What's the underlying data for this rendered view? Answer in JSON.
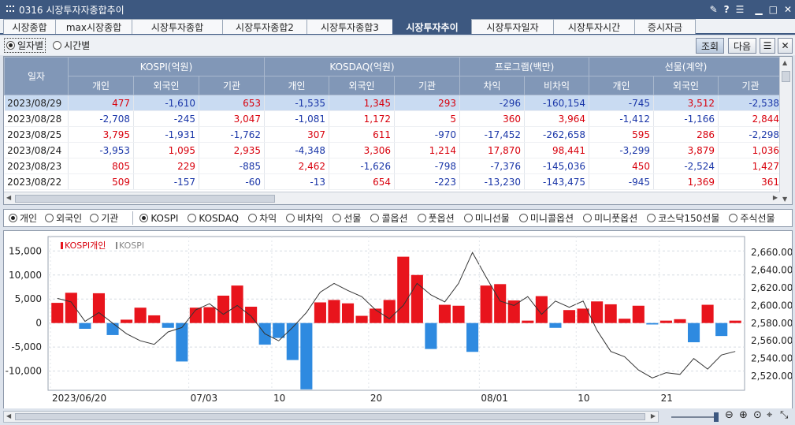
{
  "window": {
    "title": "0316 시장투자자종합추이",
    "controls": [
      "pin",
      "?",
      "menu",
      "min",
      "max",
      "close"
    ]
  },
  "tabs": [
    "시장종합",
    "max시장종합",
    "시장투자종합",
    "시장투자종합2",
    "시장투자종합3",
    "시장투자추이",
    "시장투자일자",
    "시장투자시간",
    "증시자금"
  ],
  "active_tab": 5,
  "period_options": [
    "일자별",
    "시간별"
  ],
  "buttons": {
    "query": "조회",
    "next": "다음"
  },
  "grid": {
    "date_header": "일자",
    "groups": [
      "KOSPI(억원)",
      "KOSDAQ(억원)",
      "프로그램(백만)",
      "선물(계약)"
    ],
    "subheaders": [
      "개인",
      "외국인",
      "기관",
      "개인",
      "외국인",
      "기관",
      "차익",
      "비차익",
      "개인",
      "외국인",
      "기관"
    ],
    "rows": [
      {
        "date": "2023/08/29",
        "values": [
          "477",
          "-1,610",
          "653",
          "-1,535",
          "1,345",
          "293",
          "-296",
          "-160,154",
          "-745",
          "3,512",
          "-2,538"
        ]
      },
      {
        "date": "2023/08/28",
        "values": [
          "-2,708",
          "-245",
          "3,047",
          "-1,081",
          "1,172",
          "5",
          "360",
          "3,964",
          "-1,412",
          "-1,166",
          "2,844"
        ]
      },
      {
        "date": "2023/08/25",
        "values": [
          "3,795",
          "-1,931",
          "-1,762",
          "307",
          "611",
          "-970",
          "-17,452",
          "-262,658",
          "595",
          "286",
          "-2,298"
        ]
      },
      {
        "date": "2023/08/24",
        "values": [
          "-3,953",
          "1,095",
          "2,935",
          "-4,348",
          "3,306",
          "1,214",
          "17,870",
          "98,441",
          "-3,299",
          "3,879",
          "1,036"
        ]
      },
      {
        "date": "2023/08/23",
        "values": [
          "805",
          "229",
          "-885",
          "2,462",
          "-1,626",
          "-798",
          "-7,376",
          "-145,036",
          "450",
          "-2,524",
          "1,427"
        ]
      },
      {
        "date": "2023/08/22",
        "values": [
          "509",
          "-157",
          "-60",
          "-13",
          "654",
          "-223",
          "-13,230",
          "-143,475",
          "-945",
          "1,369",
          "361"
        ]
      }
    ]
  },
  "investor_options": [
    "개인",
    "외국인",
    "기관"
  ],
  "market_options": [
    "KOSPI",
    "KOSDAQ",
    "차익",
    "비차익",
    "선물",
    "콜옵션",
    "풋옵션",
    "미니선물",
    "미니콜옵션",
    "미니풋옵션",
    "코스닥150선물",
    "주식선물"
  ],
  "colors": {
    "pos": "#d8000c",
    "neg": "#1a36a8",
    "bar_pos": "#e8141c",
    "bar_neg": "#2e8ae0",
    "header": "#8197b7",
    "title": "#3d5880"
  },
  "chart_data": {
    "type": "bar",
    "legend": [
      "KOSPI개인",
      "KOSPI"
    ],
    "x_ticks": [
      "2023/06/20",
      "07/03",
      "10",
      "20",
      "08/01",
      "10",
      "21"
    ],
    "y_left_ticks": [
      "15,000",
      "10,000",
      "5,000",
      "0",
      "-5,000",
      "-10,000"
    ],
    "y_right_ticks": [
      "2,660.00",
      "2,640.00",
      "2,620.00",
      "2,600.00",
      "2,580.00",
      "2,560.00",
      "2,540.00",
      "2,520.00"
    ],
    "ylim_left": [
      -14000,
      18000
    ],
    "ylim_right": [
      2504,
      2678
    ],
    "series": [
      {
        "name": "KOSPI개인",
        "values": [
          4200,
          6300,
          -1200,
          6200,
          -2500,
          700,
          3200,
          1600,
          -1000,
          -8000,
          3200,
          3300,
          5700,
          7800,
          3400,
          -4500,
          -3100,
          -7700,
          -13800,
          4300,
          4800,
          4100,
          1500,
          3000,
          4800,
          13800,
          10000,
          -5400,
          3800,
          3600,
          -6000,
          7800,
          8100,
          4700,
          500,
          5600,
          -1000,
          2700,
          3000,
          4500,
          3900,
          900,
          3600,
          -300,
          500,
          800,
          -4000,
          3800,
          -2700,
          500
        ]
      },
      {
        "name": "KOSPI",
        "values": [
          2608,
          2604,
          2582,
          2592,
          2580,
          2568,
          2560,
          2556,
          2570,
          2575,
          2595,
          2602,
          2590,
          2600,
          2588,
          2568,
          2560,
          2575,
          2592,
          2615,
          2625,
          2617,
          2610,
          2595,
          2585,
          2600,
          2625,
          2612,
          2604,
          2625,
          2660,
          2632,
          2605,
          2600,
          2610,
          2590,
          2605,
          2598,
          2605,
          2572,
          2548,
          2542,
          2527,
          2518,
          2524,
          2522,
          2540,
          2528,
          2544,
          2548
        ]
      }
    ]
  }
}
